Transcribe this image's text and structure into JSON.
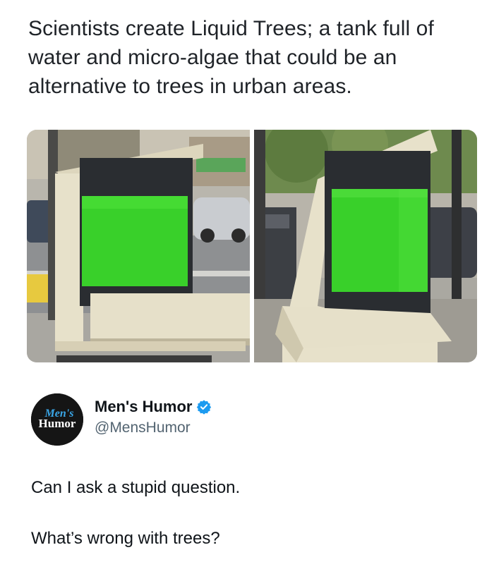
{
  "headline": "Scientists create Liquid Trees; a tank full of water and micro-algae that could be an alternative to trees in urban areas.",
  "photos": [
    {
      "description_icon": "liquid-tree-tank-front-photo"
    },
    {
      "description_icon": "liquid-tree-tank-side-photo"
    }
  ],
  "profile": {
    "display_name": "Men's Humor",
    "handle": "@MensHumor",
    "avatar_line1": "Men's",
    "avatar_line2": "Humor",
    "verified_icon": "verified-badge-icon",
    "verified_color": "#1d9bf0"
  },
  "tweet": {
    "line1": "Can I ask a stupid question.",
    "line2": "What’s wrong with trees?"
  },
  "colors": {
    "algae_green": "#39d02a",
    "bench_cream": "#e6e0c9",
    "tank_frame": "#2a2d31"
  }
}
